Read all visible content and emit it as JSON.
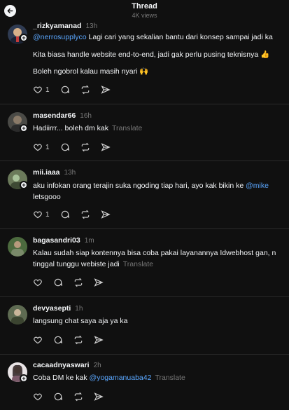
{
  "header": {
    "title": "Thread",
    "views": "4K views"
  },
  "posts": [
    {
      "username": "_rizkyamanad",
      "time": "13h",
      "mention": "@nerrosupplyco",
      "line1": " Lagi cari yang sekalian bantu dari konsep sampai jadi ka",
      "line2": "Kita biasa handle website end-to-end, jadi gak perlu pusing teknisnya 👍",
      "line3": "Boleh ngobrol kalau masih nyari 🙌",
      "likes": "1"
    },
    {
      "username": "masendar66",
      "time": "16h",
      "text": "Hadiirrr... boleh dm kak",
      "translate": "Translate",
      "likes": "1"
    },
    {
      "username": "mii.iaaa",
      "time": "13h",
      "text": "aku infokan orang terajin suka ngoding tiap hari, ayo kak bikin ke ",
      "mention": "@mike",
      "line2": "letsgooo",
      "likes": "1"
    },
    {
      "username": "bagasandri03",
      "time": "1m",
      "line1": "Kalau sudah siap kontennya bisa coba pakai layanannya Idwebhost gan, n",
      "line2": "tinggal tunggu webiste jadi",
      "translate": "Translate"
    },
    {
      "username": "devyasepti",
      "time": "1h",
      "text": "langsung chat saya aja ya ka"
    },
    {
      "username": "cacaadnyaswari",
      "time": "2h",
      "text": "Coba DM ke kak ",
      "mention": "@yogamanuaba42",
      "translate": "Translate"
    }
  ]
}
